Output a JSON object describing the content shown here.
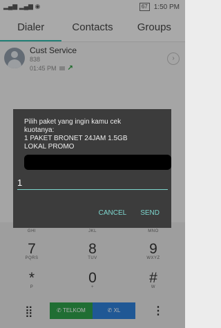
{
  "status_bar": {
    "signal_text": "ᴵᴵᴵ ᴵᴵᴵ",
    "battery": "67",
    "time": "1:50 PM"
  },
  "tabs": [
    {
      "label": "Dialer"
    },
    {
      "label": "Contacts"
    },
    {
      "label": "Groups"
    }
  ],
  "recent_call": {
    "name": "Cust Service",
    "number": "838",
    "time": "01:45 PM"
  },
  "dialog": {
    "message_lines": [
      "Pilih paket yang ingin kamu cek",
      "kuotanya:",
      "1 PAKET BRONET 24JAM 1.5GB",
      "LOKAL PROMO"
    ],
    "input_value": "1",
    "cancel_label": "CANCEL",
    "send_label": "SEND"
  },
  "keypad": [
    {
      "digit": "7",
      "letters": "PQRS"
    },
    {
      "digit": "8",
      "letters": "TUV"
    },
    {
      "digit": "9",
      "letters": "WXYZ"
    },
    {
      "digit": "*",
      "letters": "P"
    },
    {
      "digit": "0",
      "letters": "+"
    },
    {
      "digit": "#",
      "letters": "W"
    }
  ],
  "keypad_top_letters": [
    "GHI",
    "JKL",
    "MNO"
  ],
  "bottom": {
    "sim1_label": "TELKOM",
    "sim2_label": "XL"
  },
  "colors": {
    "accent": "#7ed7cf",
    "sim1": "#2e9e4a",
    "sim2": "#2f7fd6"
  }
}
